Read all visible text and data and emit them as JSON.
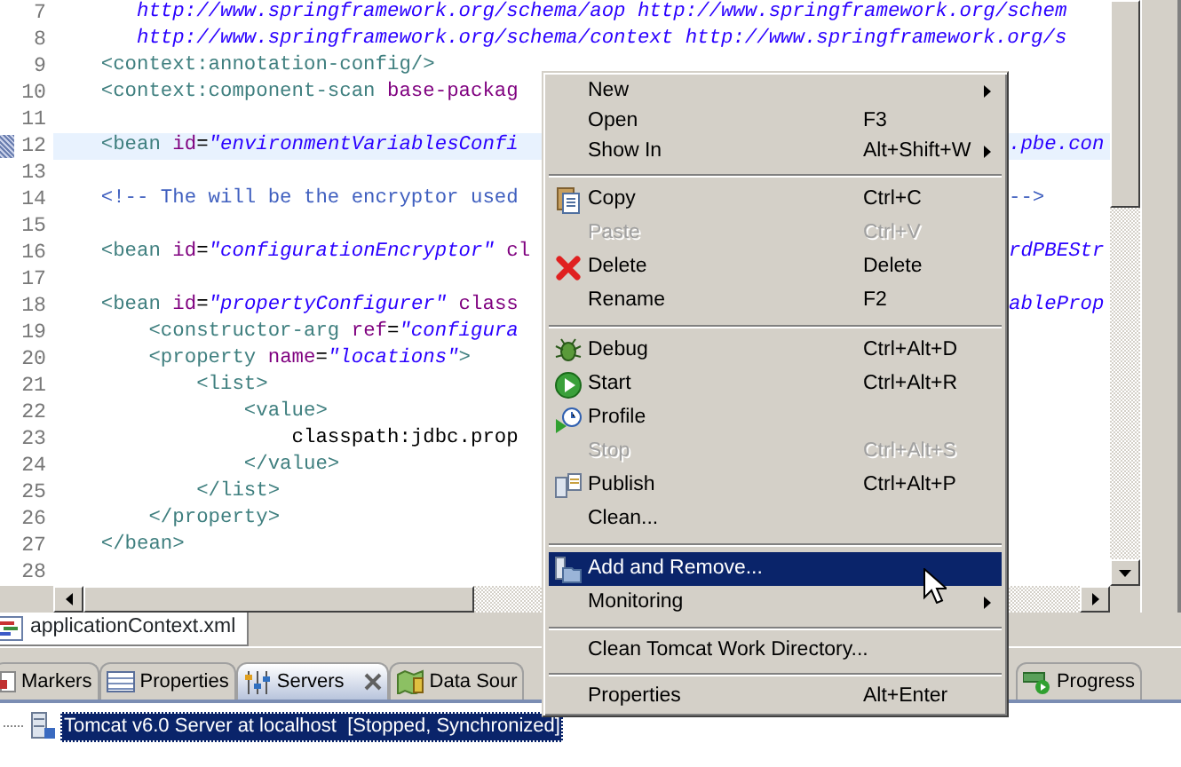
{
  "editor": {
    "lines": [
      {
        "number": "7",
        "current": false,
        "segments": [
          {
            "kind": "value",
            "text": "       http://www.springframework.org/schema/aop http://www.springframework.org/schem"
          }
        ]
      },
      {
        "number": "8",
        "current": false,
        "segments": [
          {
            "kind": "value",
            "text": "       http://www.springframework.org/schema/context http://www.springframework.org/s"
          }
        ]
      },
      {
        "number": "9",
        "current": false,
        "segments": [
          {
            "kind": "tag",
            "text": "    <context:annotation-config/>"
          }
        ]
      },
      {
        "number": "10",
        "current": false,
        "segments": [
          {
            "kind": "tag",
            "text": "    <context:component-scan"
          },
          {
            "kind": "attr",
            "text": " base-packag"
          }
        ]
      },
      {
        "number": "11",
        "current": false
      },
      {
        "number": "12",
        "current": true,
        "segments": [
          {
            "kind": "tag",
            "text": "    <bean"
          },
          {
            "kind": "attr",
            "text": " id"
          },
          {
            "kind": "text",
            "text": "="
          },
          {
            "kind": "value",
            "text": "\"environmentVariablesConfi"
          }
        ],
        "tail": [
          {
            "kind": "value",
            "text": ".pbe.con"
          }
        ]
      },
      {
        "number": "13",
        "current": false
      },
      {
        "number": "14",
        "current": false,
        "segments": [
          {
            "kind": "comment",
            "text": "    <!-- The will be the encryptor used"
          }
        ],
        "tail": [
          {
            "kind": "comment",
            "text": "-->"
          }
        ]
      },
      {
        "number": "15",
        "current": false
      },
      {
        "number": "16",
        "current": false,
        "segments": [
          {
            "kind": "tag",
            "text": "    <bean"
          },
          {
            "kind": "attr",
            "text": " id"
          },
          {
            "kind": "text",
            "text": "="
          },
          {
            "kind": "value",
            "text": "\"configurationEncryptor\""
          },
          {
            "kind": "attr",
            "text": " cl"
          }
        ],
        "tail": [
          {
            "kind": "value",
            "text": "rdPBEStr"
          }
        ]
      },
      {
        "number": "17",
        "current": false
      },
      {
        "number": "18",
        "current": false,
        "segments": [
          {
            "kind": "tag",
            "text": "    <bean"
          },
          {
            "kind": "attr",
            "text": " id"
          },
          {
            "kind": "text",
            "text": "="
          },
          {
            "kind": "value",
            "text": "\"propertyConfigurer\""
          },
          {
            "kind": "attr",
            "text": " class"
          }
        ],
        "tail": [
          {
            "kind": "value",
            "text": "ableProp"
          }
        ]
      },
      {
        "number": "19",
        "current": false,
        "segments": [
          {
            "kind": "tag",
            "text": "        <constructor-arg"
          },
          {
            "kind": "attr",
            "text": " ref"
          },
          {
            "kind": "text",
            "text": "="
          },
          {
            "kind": "value",
            "text": "\"configura"
          }
        ]
      },
      {
        "number": "20",
        "current": false,
        "segments": [
          {
            "kind": "tag",
            "text": "        <property"
          },
          {
            "kind": "attr",
            "text": " name"
          },
          {
            "kind": "text",
            "text": "="
          },
          {
            "kind": "value",
            "text": "\"locations\""
          },
          {
            "kind": "tag",
            "text": ">"
          }
        ]
      },
      {
        "number": "21",
        "current": false,
        "segments": [
          {
            "kind": "tag",
            "text": "            <list>"
          }
        ]
      },
      {
        "number": "22",
        "current": false,
        "segments": [
          {
            "kind": "tag",
            "text": "                <value>"
          }
        ]
      },
      {
        "number": "23",
        "current": false,
        "segments": [
          {
            "kind": "text",
            "text": "                    classpath:jdbc.prop"
          }
        ]
      },
      {
        "number": "24",
        "current": false,
        "segments": [
          {
            "kind": "tag",
            "text": "                </value>"
          }
        ]
      },
      {
        "number": "25",
        "current": false,
        "segments": [
          {
            "kind": "tag",
            "text": "            </list>"
          }
        ]
      },
      {
        "number": "26",
        "current": false,
        "segments": [
          {
            "kind": "tag",
            "text": "        </property>"
          }
        ]
      },
      {
        "number": "27",
        "current": false,
        "segments": [
          {
            "kind": "tag",
            "text": "    </bean>"
          }
        ]
      },
      {
        "number": "28",
        "current": false
      }
    ],
    "tab": {
      "label": "applicationContext.xml"
    }
  },
  "views": {
    "tabs": [
      {
        "label": "Markers",
        "selected": false
      },
      {
        "label": "Properties",
        "selected": false
      },
      {
        "label": "Servers",
        "selected": true
      },
      {
        "label": "Data Sour",
        "selected": false
      }
    ],
    "trailing_tabs": [
      {
        "label": "Progress",
        "selected": false
      }
    ]
  },
  "servers": [
    {
      "label": "Tomcat v6.0 Server at localhost  [Stopped, Synchronized]",
      "selected": true
    }
  ],
  "context_menu": {
    "items": [
      {
        "kind": "item",
        "label": "New",
        "submenu": true,
        "disabled": false,
        "selected": false
      },
      {
        "kind": "item",
        "label": "Open",
        "shortcut": "F3",
        "submenu": false,
        "disabled": false,
        "selected": false
      },
      {
        "kind": "item",
        "label": "Show In",
        "shortcut": "Alt+Shift+W",
        "submenu": true,
        "disabled": false,
        "selected": false
      },
      {
        "kind": "separator"
      },
      {
        "kind": "item",
        "label": "Copy",
        "shortcut": "Ctrl+C",
        "submenu": false,
        "disabled": false,
        "selected": false
      },
      {
        "kind": "item",
        "label": "Paste",
        "shortcut": "Ctrl+V",
        "submenu": false,
        "disabled": true,
        "selected": false
      },
      {
        "kind": "item",
        "label": "Delete",
        "shortcut": "Delete",
        "submenu": false,
        "disabled": false,
        "selected": false
      },
      {
        "kind": "item",
        "label": "Rename",
        "shortcut": "F2",
        "submenu": false,
        "disabled": false,
        "selected": false
      },
      {
        "kind": "separator"
      },
      {
        "kind": "item",
        "label": "Debug",
        "shortcut": "Ctrl+Alt+D",
        "submenu": false,
        "disabled": false,
        "selected": false
      },
      {
        "kind": "item",
        "label": "Start",
        "shortcut": "Ctrl+Alt+R",
        "submenu": false,
        "disabled": false,
        "selected": false
      },
      {
        "kind": "item",
        "label": "Profile",
        "submenu": false,
        "disabled": false,
        "selected": false
      },
      {
        "kind": "item",
        "label": "Stop",
        "shortcut": "Ctrl+Alt+S",
        "submenu": false,
        "disabled": true,
        "selected": false
      },
      {
        "kind": "item",
        "label": "Publish",
        "shortcut": "Ctrl+Alt+P",
        "submenu": false,
        "disabled": false,
        "selected": false
      },
      {
        "kind": "item",
        "label": "Clean...",
        "submenu": false,
        "disabled": false,
        "selected": false
      },
      {
        "kind": "separator"
      },
      {
        "kind": "item",
        "label": "Add and Remove...",
        "submenu": false,
        "disabled": false,
        "selected": true
      },
      {
        "kind": "item",
        "label": "Monitoring",
        "submenu": true,
        "disabled": false,
        "selected": false
      },
      {
        "kind": "separator"
      },
      {
        "kind": "item",
        "label": "Clean Tomcat Work Directory...",
        "submenu": false,
        "disabled": false,
        "selected": false
      },
      {
        "kind": "separator"
      },
      {
        "kind": "item",
        "label": "Properties",
        "shortcut": "Alt+Enter",
        "submenu": false,
        "disabled": false,
        "selected": false
      }
    ]
  }
}
